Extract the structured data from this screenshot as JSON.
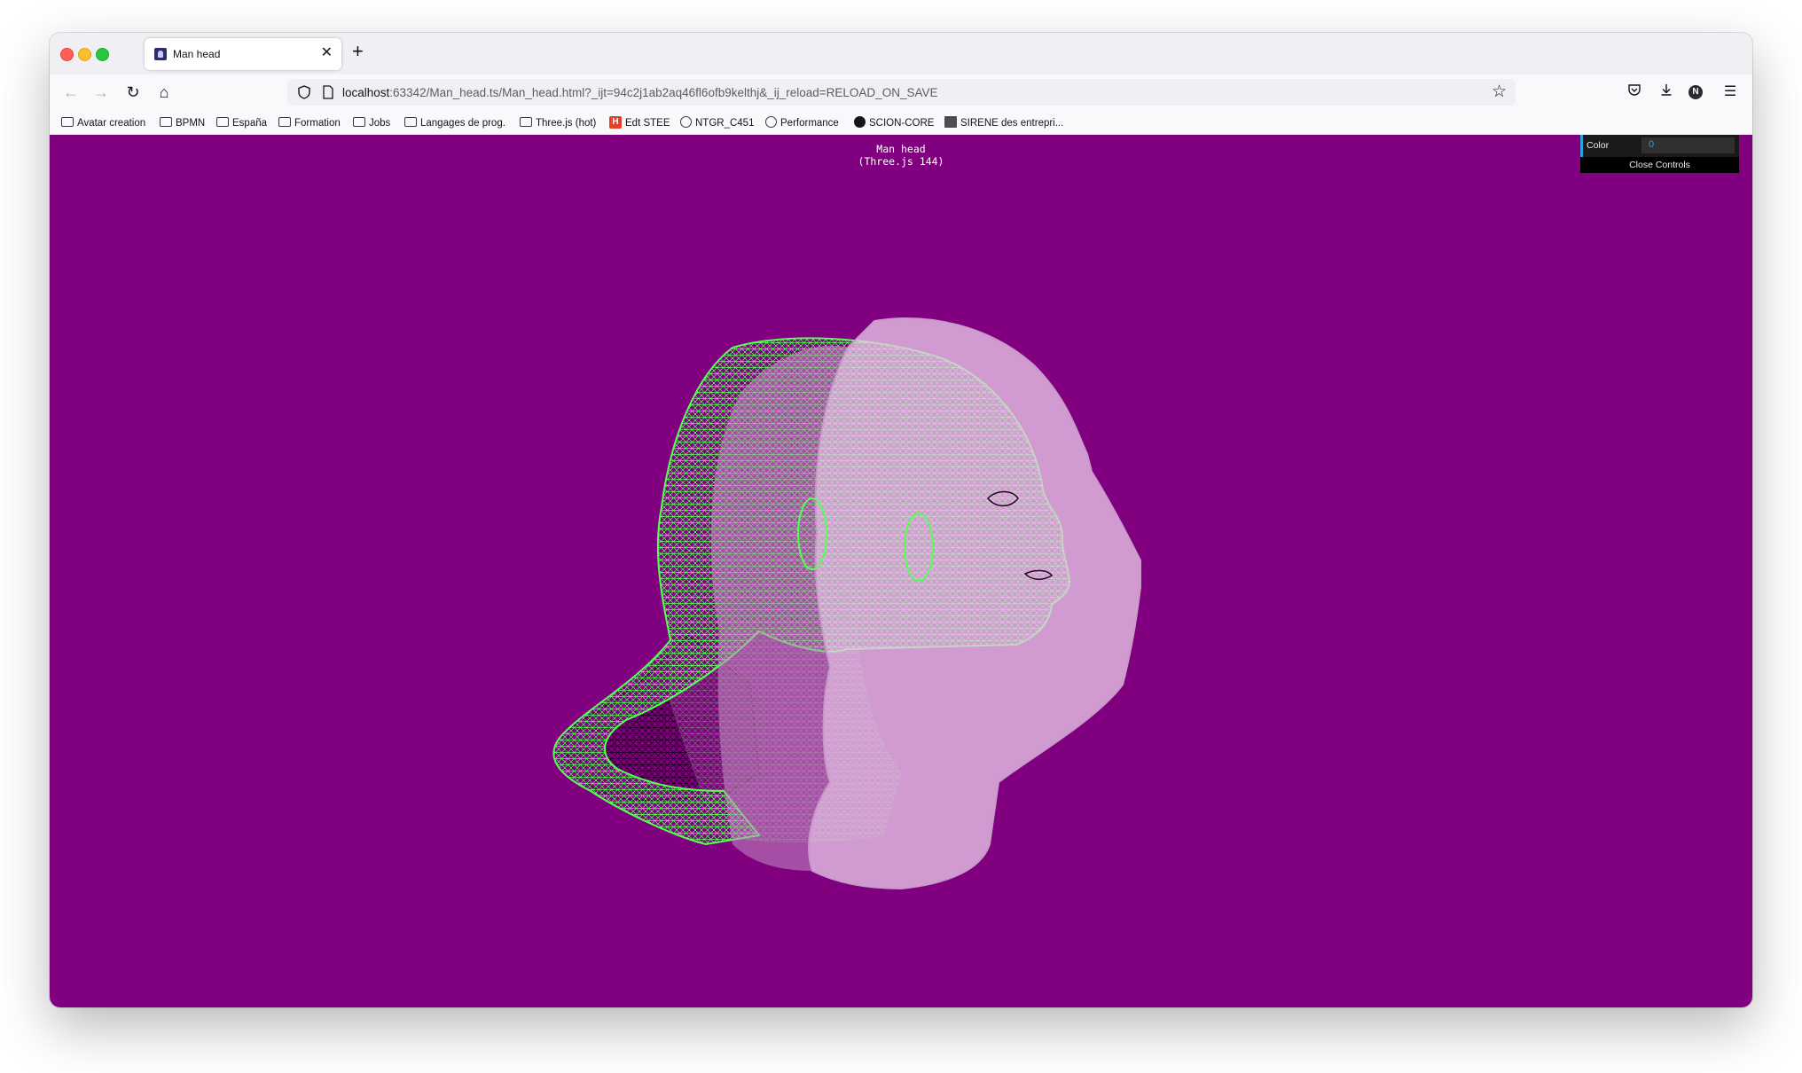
{
  "browser": {
    "tab": {
      "title": "Man head"
    },
    "url": {
      "host": "localhost",
      "rest": ":63342/Man_head.ts/Man_head.html?_ijt=94c2j1ab2aq46fl6ofb9kelthj&_ij_reload=RELOAD_ON_SAVE"
    },
    "account_initial": "N"
  },
  "bookmarks": [
    {
      "label": "Avatar creation",
      "icon": "folder-icon"
    },
    {
      "label": "BPMN",
      "icon": "folder-icon"
    },
    {
      "label": "España",
      "icon": "folder-icon"
    },
    {
      "label": "Formation",
      "icon": "folder-icon"
    },
    {
      "label": "Jobs",
      "icon": "folder-icon"
    },
    {
      "label": "Langages de prog.",
      "icon": "folder-icon"
    },
    {
      "label": "Three.js (hot)",
      "icon": "folder-icon"
    },
    {
      "label": "Edt STEE",
      "icon": "h-icon"
    },
    {
      "label": "NTGR_C451",
      "icon": "globe-icon"
    },
    {
      "label": "Performance",
      "icon": "globe-icon"
    },
    {
      "label": "SCION-CORE",
      "icon": "github-icon"
    },
    {
      "label": "SIRENE des entrepri...",
      "icon": "sirene-icon"
    }
  ],
  "page": {
    "title_line1": "Man head",
    "title_line2": "(Three.js 144)",
    "background": "#800080",
    "gui": {
      "color_label": "Color",
      "color_value": "0",
      "close_label": "Close Controls"
    }
  },
  "colors": {
    "wireframe": "#55ff55",
    "ghost_head": "#e4bce4",
    "accent": "#2fa1d6"
  }
}
